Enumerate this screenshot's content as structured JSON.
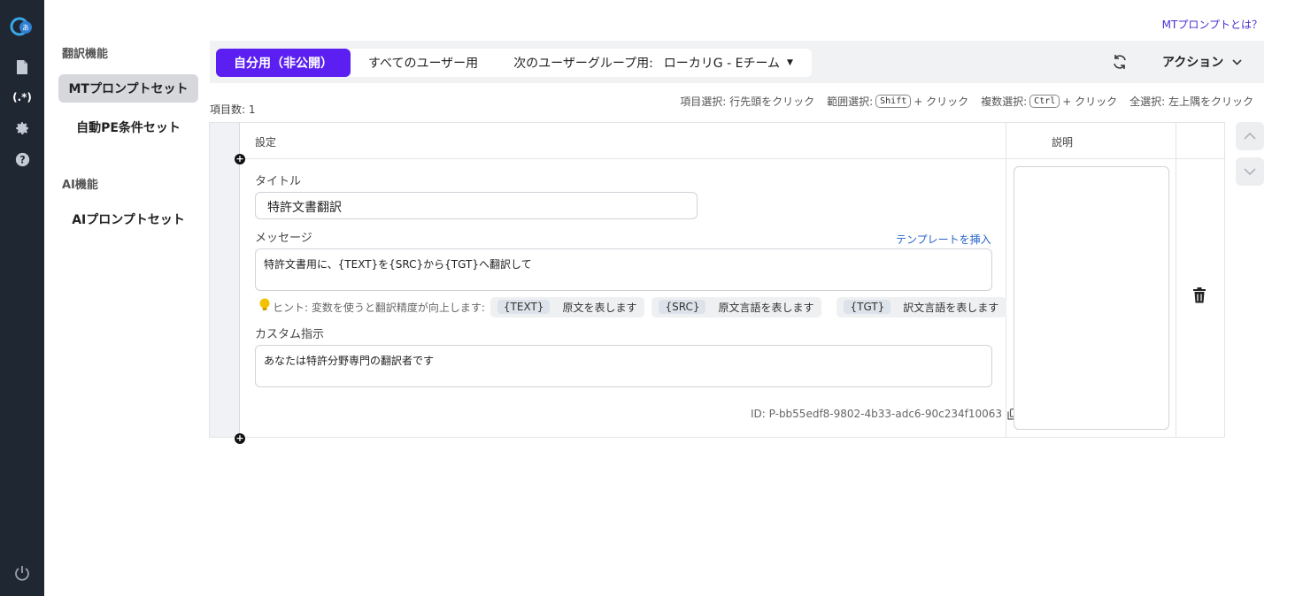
{
  "help": {
    "label": "MTプロンプトとは？"
  },
  "subnav": {
    "sec1": "翻訳機能",
    "item1": "MTプロンプトセット",
    "item2": "自動PE条件セット",
    "sec2": "AI機能",
    "item3": "AIプロンプトセット"
  },
  "toolbar": {
    "tab_private": "自分用（非公開）",
    "tab_all": "すべてのユーザー用",
    "tab_group": "次のユーザーグループ用:",
    "group_value": "ローカリG - Eチーム",
    "actions": "アクション"
  },
  "list": {
    "count": "項目数: 1",
    "hint_item": "項目選択: 行先頭をクリック",
    "hint_range": "範囲選択:",
    "key_shift": "Shift",
    "hint_click1": "+ クリック",
    "hint_multi": "複数選択:",
    "key_ctrl": "Ctrl",
    "hint_click2": "+ クリック",
    "hint_all": "全選択: 左上隅をクリック"
  },
  "table": {
    "col_settings": "設定",
    "col_desc": "説明"
  },
  "row": {
    "title_label": "タイトル",
    "title_value": "特許文書翻訳",
    "message_label": "メッセージ",
    "template_link": "テンプレートを挿入",
    "message_value": "特許文書用に、{TEXT}を{SRC}から{TGT}へ翻訳して",
    "hint_text": "ヒント: 変数を使うと翻訳精度が向上します:",
    "chips": [
      {
        "code": "{TEXT}",
        "desc": "原文を表します"
      },
      {
        "code": "{SRC}",
        "desc": "原文言語を表します"
      },
      {
        "code": "{TGT}",
        "desc": "訳文言語を表します"
      }
    ],
    "custom_label": "カスタム指示",
    "custom_value": "あなたは特許分野専門の翻訳者です",
    "id": "ID: P-bb55edf8-9802-4b33-adc6-90c234f10063"
  },
  "colors": {
    "accent": "#5b1ff1",
    "rail": "#1f2733",
    "link": "#2a64c9"
  }
}
